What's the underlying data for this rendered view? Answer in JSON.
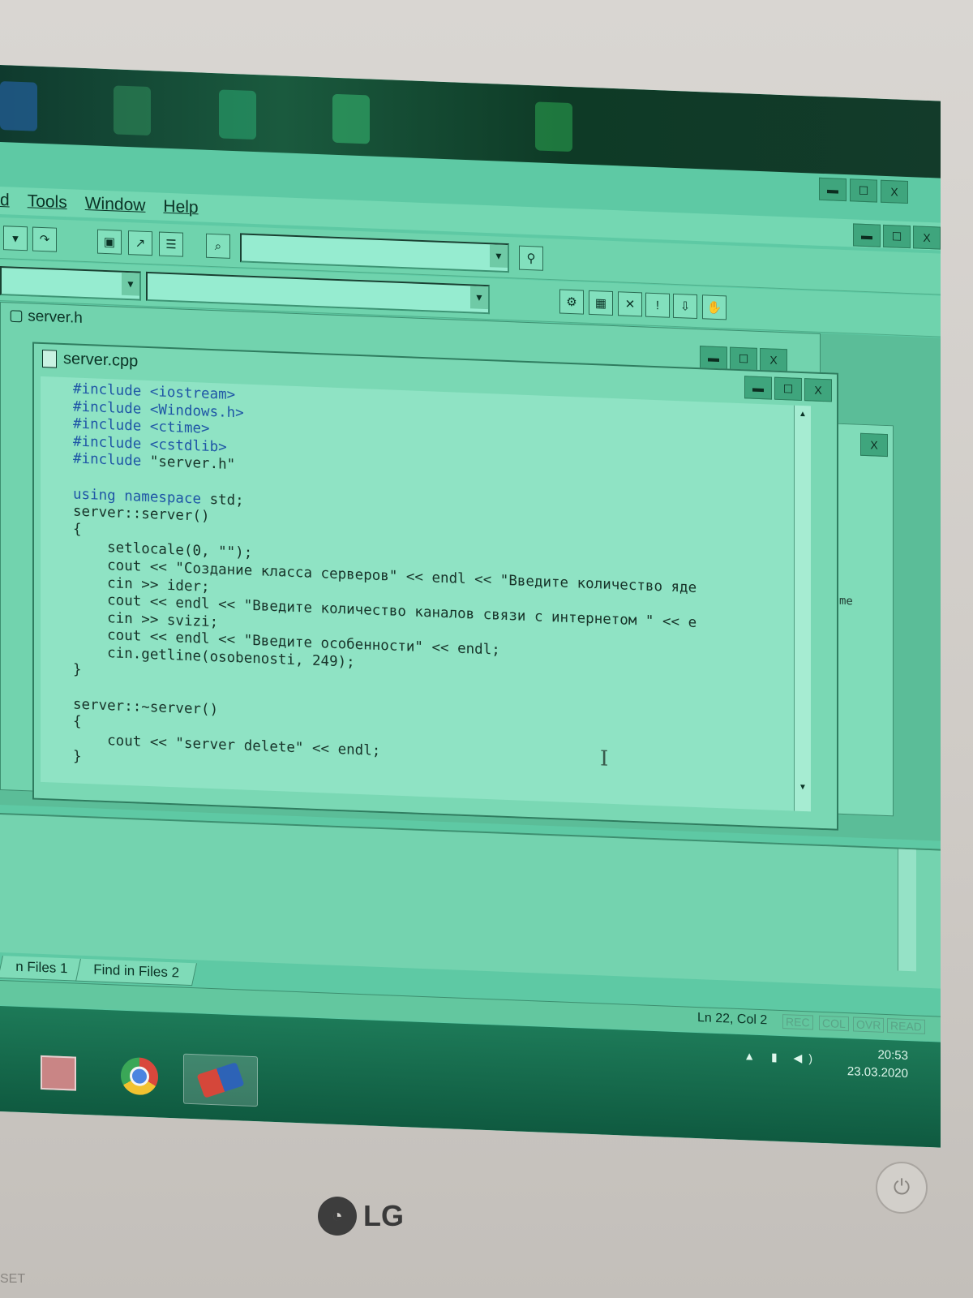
{
  "menu": {
    "items": [
      "d",
      "Tools",
      "Window",
      "Help"
    ]
  },
  "window_controls": {
    "minimize": "▬",
    "maximize": "☐",
    "close": "X"
  },
  "back_doc": {
    "title": "server.h"
  },
  "front_doc": {
    "title": "server.cpp",
    "code_lines": [
      [
        {
          "t": "#include <iostream>",
          "k": true
        }
      ],
      [
        {
          "t": "#include <Windows.h>",
          "k": true
        }
      ],
      [
        {
          "t": "#include <ctime>",
          "k": true
        }
      ],
      [
        {
          "t": "#include <cstdlib>",
          "k": true
        }
      ],
      [
        {
          "t": "#include ",
          "k": true
        },
        {
          "t": "\"server.h\"",
          "k": false
        }
      ],
      [
        {
          "t": "",
          "k": false
        }
      ],
      [
        {
          "t": "using namespace ",
          "k": true
        },
        {
          "t": "std;",
          "k": false
        }
      ],
      [
        {
          "t": "server::server()",
          "k": false
        }
      ],
      [
        {
          "t": "{",
          "k": false
        }
      ],
      [
        {
          "t": "    setlocale(0, \"\");",
          "k": false
        }
      ],
      [
        {
          "t": "    cout << \"Создание класса серверов\" << endl << \"Введите количество яде",
          "k": false
        }
      ],
      [
        {
          "t": "    cin >> ider;",
          "k": false
        }
      ],
      [
        {
          "t": "    cout << endl << \"Введите количество каналов связи с интернетом \" << e",
          "k": false
        }
      ],
      [
        {
          "t": "    cin >> svizi;",
          "k": false
        }
      ],
      [
        {
          "t": "    cout << endl << \"Введите особенности\" << endl;",
          "k": false
        }
      ],
      [
        {
          "t": "    cin.getline(osobenosti, 249);",
          "k": false
        }
      ],
      [
        {
          "t": "}",
          "k": false
        }
      ],
      [
        {
          "t": "",
          "k": false
        }
      ],
      [
        {
          "t": "server::~server()",
          "k": false
        }
      ],
      [
        {
          "t": "{",
          "k": false
        }
      ],
      [
        {
          "t": "    cout << \"server delete\" << endl;",
          "k": false
        }
      ],
      [
        {
          "t": "}",
          "k": false
        }
      ]
    ]
  },
  "right_doc": {
    "fragment": "me"
  },
  "output_tabs": [
    "n Files 1",
    "Find in Files 2"
  ],
  "status": {
    "position": "Ln 22, Col 2",
    "indicators": [
      "REC",
      "COL",
      "OVR",
      "READ"
    ]
  },
  "tray": {
    "time": "20:53",
    "date": "23.03.2020"
  },
  "taskbar": {
    "apps": [
      "paint-icon",
      "chrome-icon",
      "ide-icon"
    ]
  },
  "monitor": {
    "brand": "LG",
    "corner_text": "SET"
  }
}
